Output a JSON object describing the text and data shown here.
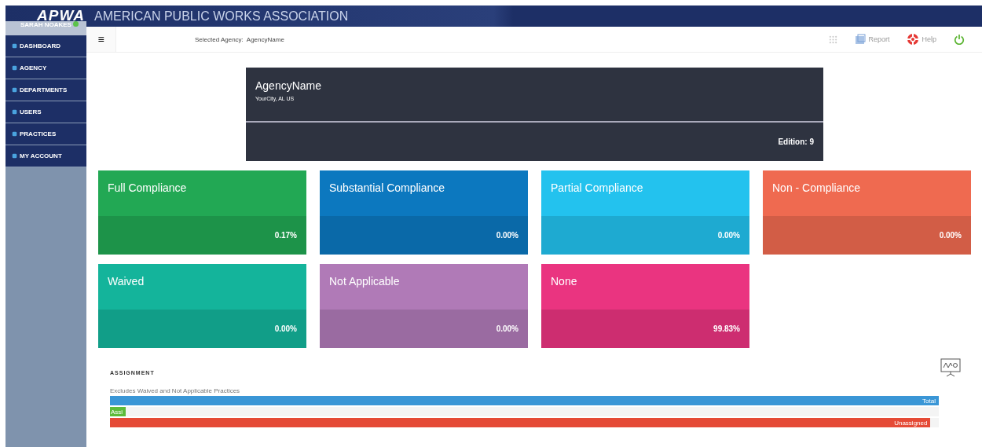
{
  "header": {
    "logo": "APWA",
    "title": "AMERICAN PUBLIC WORKS ASSOCIATION"
  },
  "sidebar": {
    "user": "SARAH NOAKES",
    "online": true,
    "items": [
      {
        "label": "DASHBOARD",
        "selected": false
      },
      {
        "label": "AGENCY",
        "selected": false
      },
      {
        "label": "DEPARTMENTS",
        "selected": false
      },
      {
        "label": "USERS",
        "selected": false
      },
      {
        "label": "PRACTICES",
        "selected": false
      },
      {
        "label": "MY ACCOUNT",
        "selected": false
      }
    ]
  },
  "topbar": {
    "menu": "≡",
    "selected_agency_label": "Selected Agency:",
    "selected_agency": "AgencyName",
    "actions": [
      {
        "kind": "grid"
      },
      {
        "kind": "report",
        "label": "Report"
      },
      {
        "kind": "help",
        "label": "Help"
      },
      {
        "kind": "power"
      }
    ]
  },
  "agency": {
    "name": "AgencyName",
    "location": "YourCity, AL US",
    "edition": "Edition: 9"
  },
  "cards": [
    {
      "title": "Full Compliance",
      "value": "0.17%",
      "color": "#22a854"
    },
    {
      "title": "Substantial Compliance",
      "value": "0.00%",
      "color": "#0c78bf"
    },
    {
      "title": "Partial Compliance",
      "value": "0.00%",
      "color": "#23c2ee"
    },
    {
      "title": "Non - Compliance",
      "value": "0.00%",
      "color": "#ef6a50"
    },
    {
      "title": "Waived",
      "value": "0.00%",
      "color": "#14b49b"
    },
    {
      "title": "Not Applicable",
      "value": "0.00%",
      "color": "#b07ab7"
    },
    {
      "title": "None",
      "value": "99.83%",
      "color": "#ea3480"
    }
  ],
  "assignment": {
    "title": "ASSIGNMENT",
    "note": "Excludes Waived and Not Applicable Practices",
    "bars": [
      {
        "label": "Total",
        "level": 1,
        "color": "#3a96d6"
      },
      {
        "label": "Assi",
        "level": 0.016,
        "color": "#5dbb3a"
      },
      {
        "label": "Unassigned",
        "level": 0.99,
        "color": "#e54a36"
      }
    ]
  }
}
